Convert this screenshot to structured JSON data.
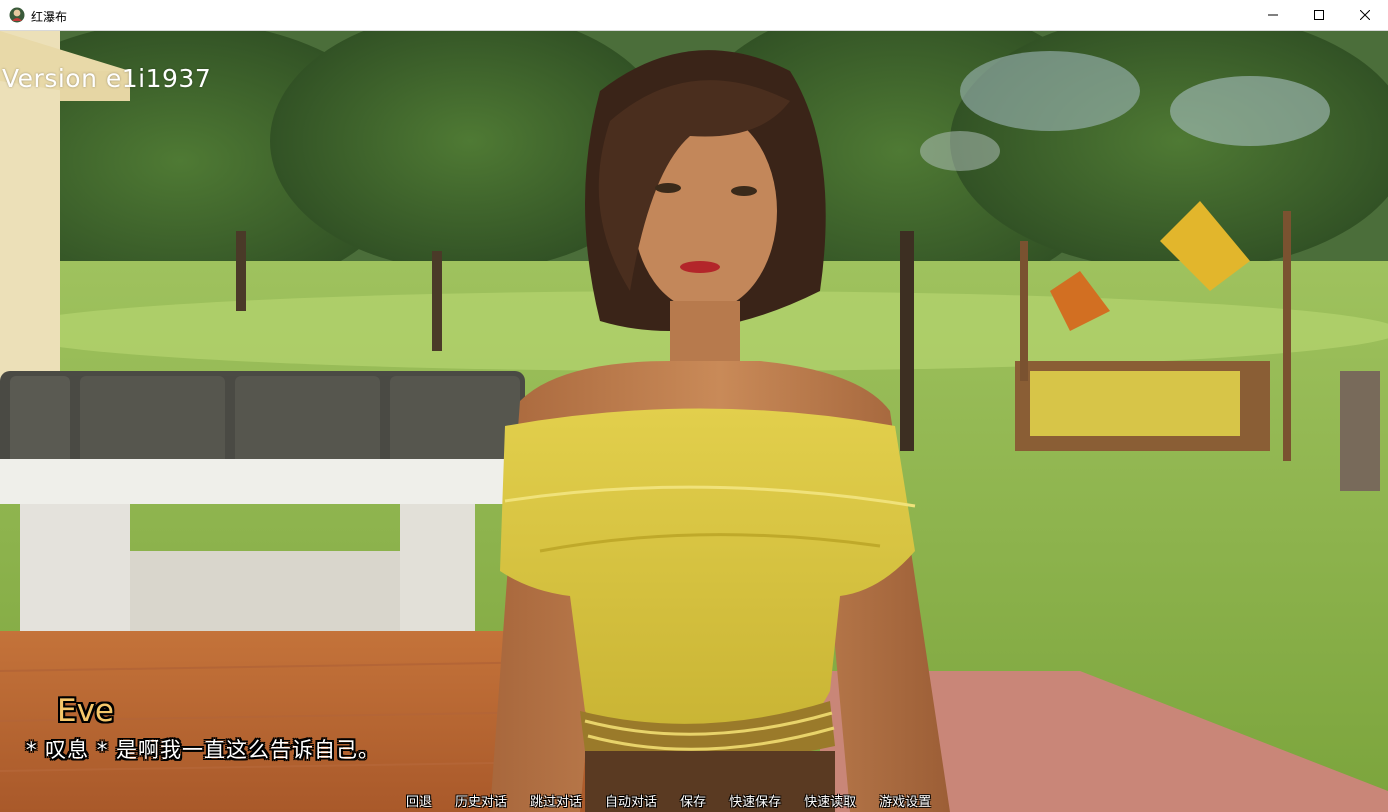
{
  "window": {
    "title": "红瀑布",
    "icon": "game-app-icon"
  },
  "game": {
    "version_label": "Version e1i1937",
    "speaker_name": "Eve",
    "dialogue_text": "* 叹息 * 是啊我一直这么告诉自己。",
    "speaker_color": "#f6c86b"
  },
  "quick_menu": [
    {
      "label": "回退"
    },
    {
      "label": "历史对话"
    },
    {
      "label": "跳过对话"
    },
    {
      "label": "自动对话"
    },
    {
      "label": "保存"
    },
    {
      "label": "快速保存"
    },
    {
      "label": "快速读取"
    },
    {
      "label": "游戏设置"
    }
  ]
}
